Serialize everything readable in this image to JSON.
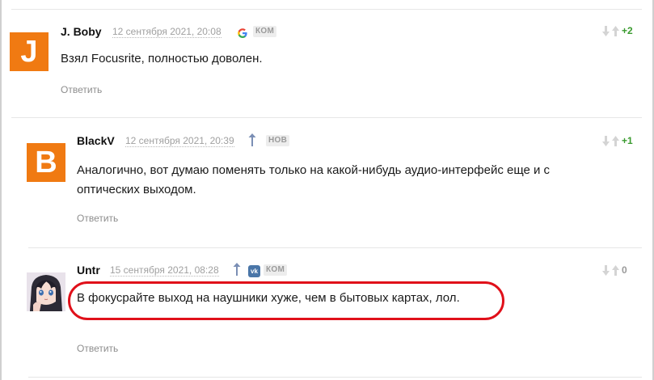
{
  "comments": [
    {
      "author": "J. Boby",
      "avatar_letter": "J",
      "date": "12 сентября 2021, 20:08",
      "source_icon": "google-icon",
      "badge": "КОМ",
      "text": "Взял Focusrite, полностью доволен.",
      "reply": "Ответить",
      "score": "+2"
    },
    {
      "author": "BlackV",
      "avatar_letter": "B",
      "date": "12 сентября 2021, 20:39",
      "source_icon": "up-arrow-icon",
      "badge": "НОВ",
      "text": "Аналогично, вот думаю поменять только на какой-нибудь аудио-интерфейс еще и с оптических выходом.",
      "reply": "Ответить",
      "score": "+1"
    },
    {
      "author": "Untr",
      "avatar_letter": "",
      "date": "15 сентября 2021, 08:28",
      "source_icon": "vk-icon",
      "badge": "КОМ",
      "text": "В фокусрайте выход на наушники хуже, чем в бытовых картах, лол.",
      "reply": "Ответить",
      "score": "0"
    }
  ],
  "colors": {
    "avatar": "#f07a12",
    "positive_score": "#3a9b2f",
    "neutral_score": "#999999",
    "highlight": "#e0101a",
    "vk": "#4a76a8"
  }
}
